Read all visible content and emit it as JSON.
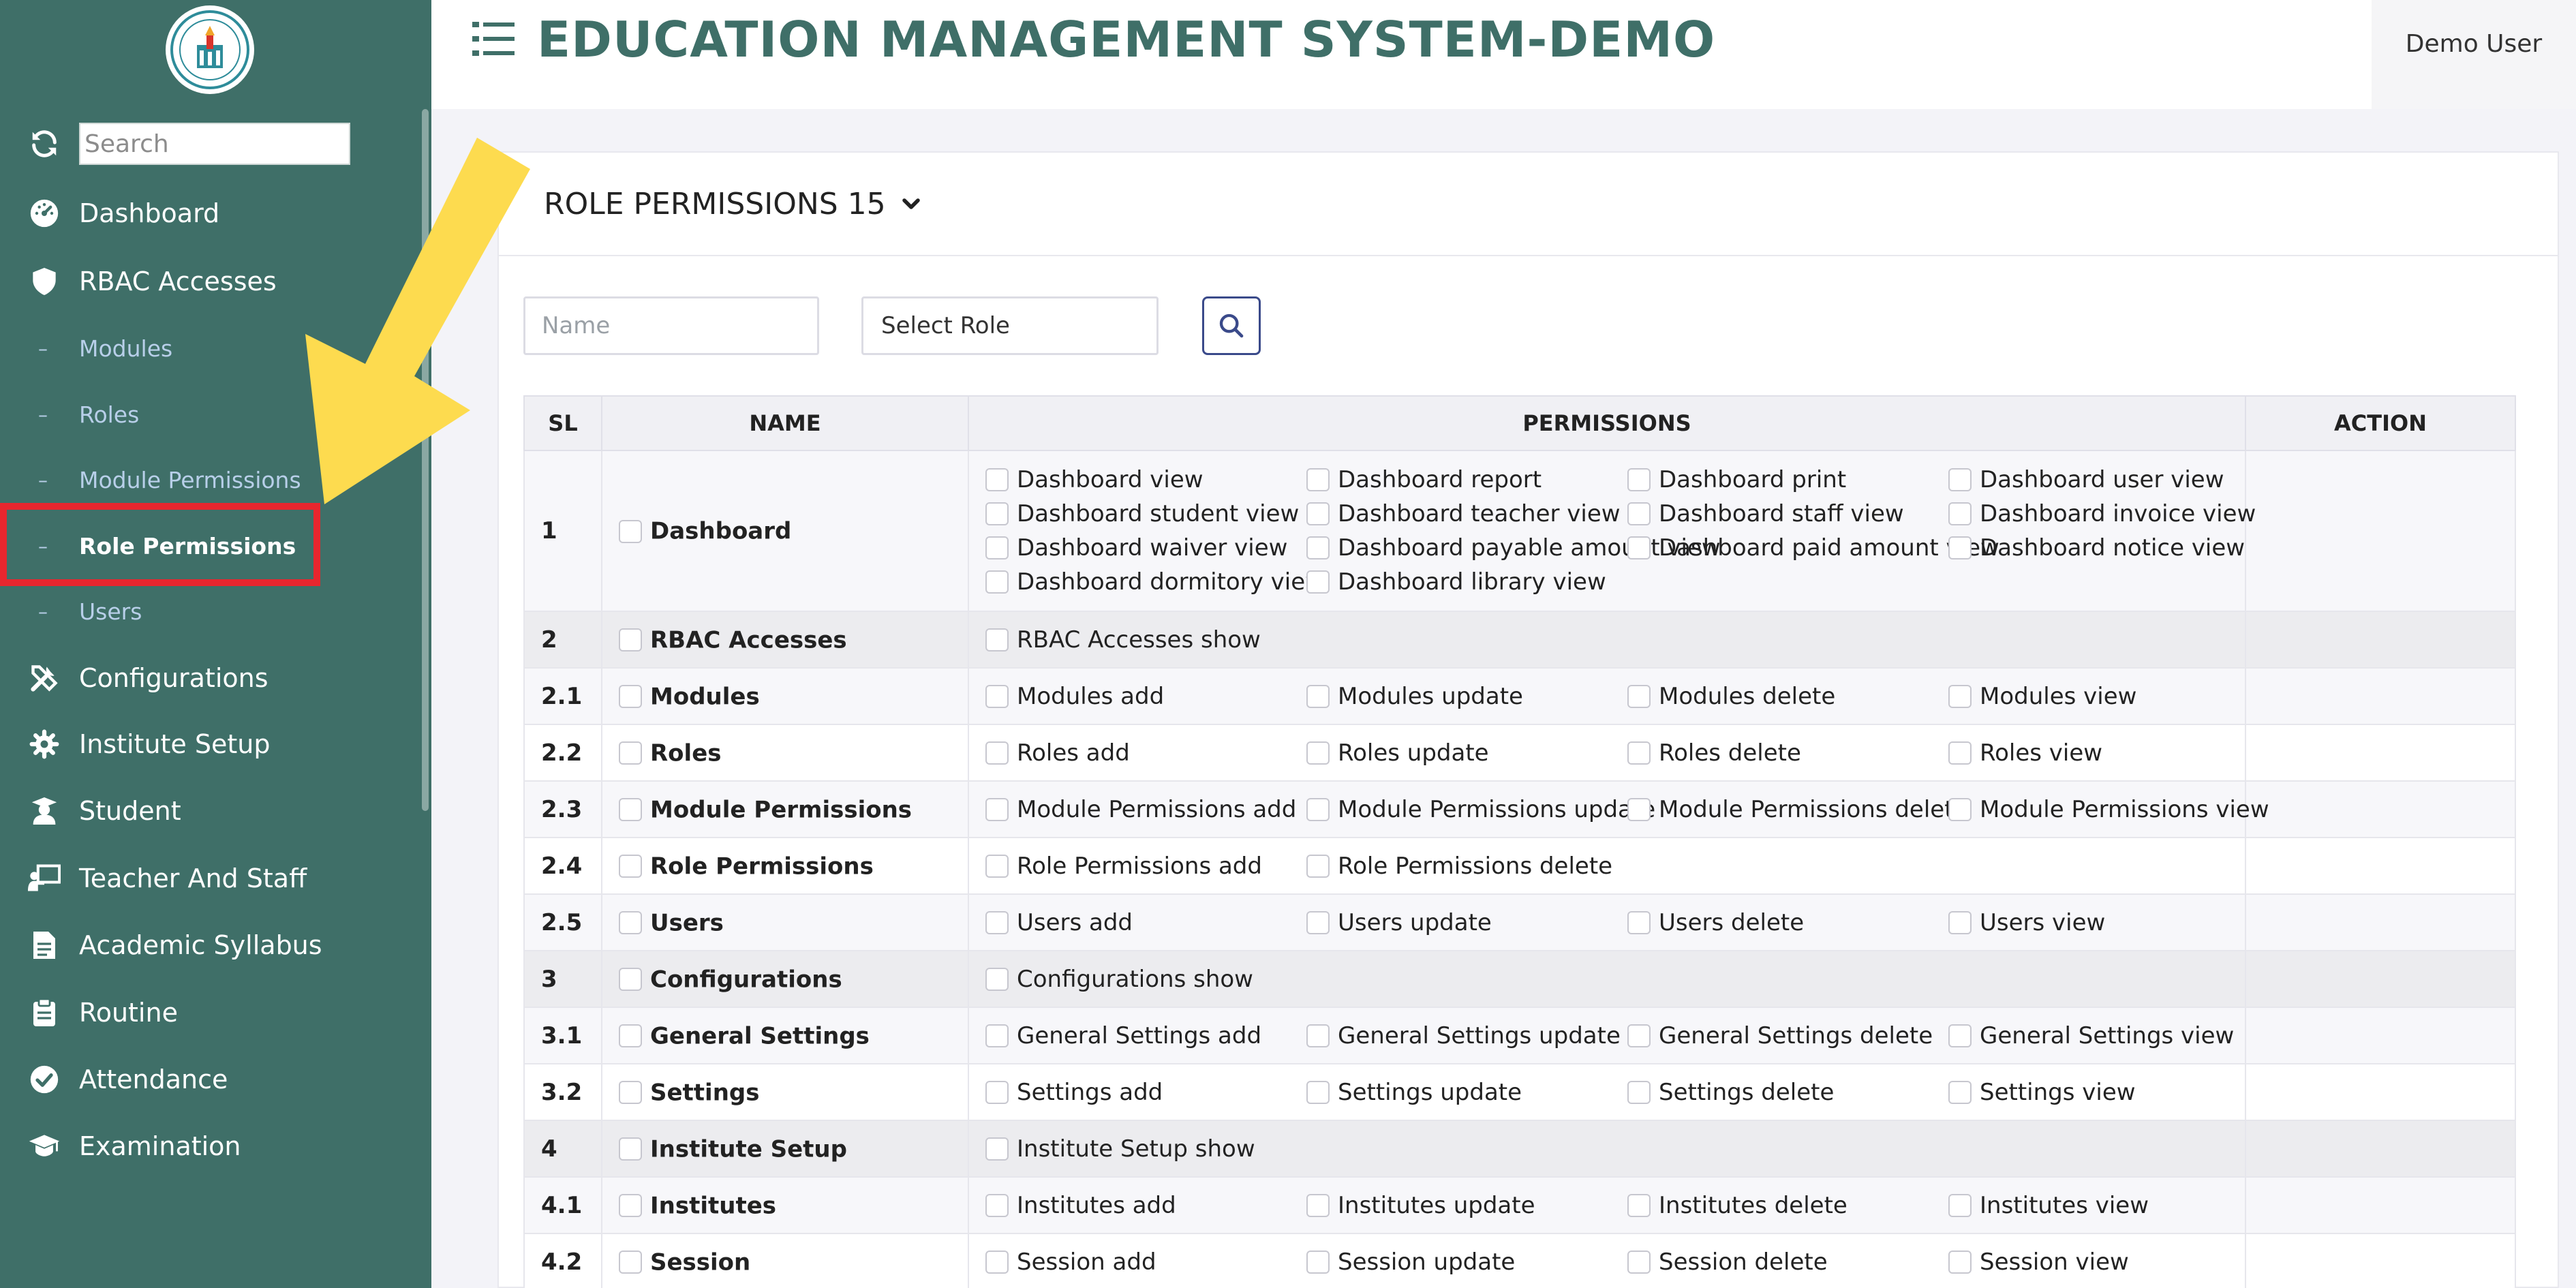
{
  "sidebar": {
    "search_placeholder": "Search",
    "nav_top": [
      {
        "label": "Dashboard",
        "icon": "dashboard-gauge-icon"
      },
      {
        "label": "RBAC Accesses",
        "icon": "shield-icon"
      }
    ],
    "sub_items": [
      {
        "label": "Modules",
        "active": false
      },
      {
        "label": "Roles",
        "active": false
      },
      {
        "label": "Module Permissions",
        "active": false
      },
      {
        "label": "Role Permissions",
        "active": true
      },
      {
        "label": "Users",
        "active": false
      }
    ],
    "nav_bottom": [
      {
        "label": "Configurations",
        "icon": "tools-icon"
      },
      {
        "label": "Institute Setup",
        "icon": "gear-icon"
      },
      {
        "label": "Student",
        "icon": "student-icon"
      },
      {
        "label": "Teacher And Staff",
        "icon": "chalkboard-teacher-icon"
      },
      {
        "label": "Academic Syllabus",
        "icon": "document-icon"
      },
      {
        "label": "Routine",
        "icon": "clipboard-icon"
      },
      {
        "label": "Attendance",
        "icon": "check-circle-icon"
      },
      {
        "label": "Examination",
        "icon": "graduation-cap-icon"
      }
    ]
  },
  "header": {
    "title": "EDUCATION MANAGEMENT SYSTEM-DEMO",
    "user": "Demo User"
  },
  "card": {
    "title": "ROLE PERMISSIONS 15",
    "filters": {
      "name_placeholder": "Name",
      "role_select": "Select Role"
    }
  },
  "table": {
    "headers": {
      "sl": "SL",
      "name": "NAME",
      "permissions": "PERMISSIONS",
      "action": "ACTION"
    },
    "rows": [
      {
        "sl": "1",
        "name": "Dashboard",
        "kind": "odd",
        "permissions": [
          "Dashboard view",
          "Dashboard report",
          "Dashboard print",
          "Dashboard user view",
          "Dashboard student view",
          "Dashboard teacher view",
          "Dashboard staff view",
          "Dashboard invoice view",
          "Dashboard waiver view",
          "Dashboard payable amount view",
          "Dashboard paid amount view",
          "Dashboard notice view",
          "Dashboard dormitory view",
          "Dashboard library view"
        ]
      },
      {
        "sl": "2",
        "name": "RBAC Accesses",
        "kind": "group",
        "permissions": [
          "RBAC Accesses show"
        ]
      },
      {
        "sl": "2.1",
        "name": "Modules",
        "kind": "odd",
        "permissions": [
          "Modules add",
          "Modules update",
          "Modules delete",
          "Modules view"
        ]
      },
      {
        "sl": "2.2",
        "name": "Roles",
        "kind": "even",
        "permissions": [
          "Roles add",
          "Roles update",
          "Roles delete",
          "Roles view"
        ]
      },
      {
        "sl": "2.3",
        "name": "Module Permissions",
        "kind": "odd",
        "permissions": [
          "Module Permissions add",
          "Module Permissions update",
          "Module Permissions delete",
          "Module Permissions view"
        ]
      },
      {
        "sl": "2.4",
        "name": "Role Permissions",
        "kind": "even",
        "permissions": [
          "Role Permissions add",
          "Role Permissions delete"
        ]
      },
      {
        "sl": "2.5",
        "name": "Users",
        "kind": "odd",
        "permissions": [
          "Users add",
          "Users update",
          "Users delete",
          "Users view"
        ]
      },
      {
        "sl": "3",
        "name": "Configurations",
        "kind": "group",
        "permissions": [
          "Configurations show"
        ]
      },
      {
        "sl": "3.1",
        "name": "General Settings",
        "kind": "odd",
        "permissions": [
          "General Settings add",
          "General Settings update",
          "General Settings delete",
          "General Settings view"
        ]
      },
      {
        "sl": "3.2",
        "name": "Settings",
        "kind": "even",
        "permissions": [
          "Settings add",
          "Settings update",
          "Settings delete",
          "Settings view"
        ]
      },
      {
        "sl": "4",
        "name": "Institute Setup",
        "kind": "group",
        "permissions": [
          "Institute Setup show"
        ]
      },
      {
        "sl": "4.1",
        "name": "Institutes",
        "kind": "odd",
        "permissions": [
          "Institutes add",
          "Institutes update",
          "Institutes delete",
          "Institutes view"
        ]
      },
      {
        "sl": "4.2",
        "name": "Session",
        "kind": "even",
        "permissions": [
          "Session add",
          "Session update",
          "Session delete",
          "Session view"
        ]
      }
    ]
  },
  "colors": {
    "sidebar_bg": "#3f6f68",
    "accent": "#3f6f68",
    "highlight_red": "#e8262e",
    "arrow_yellow": "#fddb4f",
    "submenu_text": "#b8cfe9"
  }
}
